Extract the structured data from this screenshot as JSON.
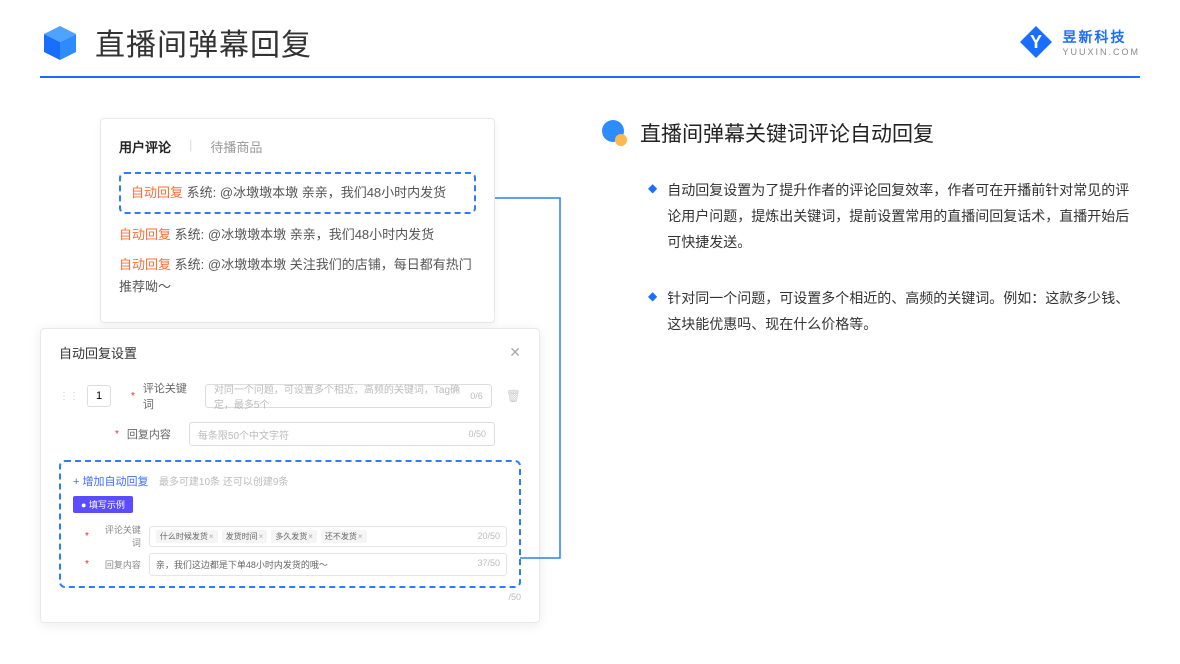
{
  "header": {
    "title": "直播间弹幕回复",
    "brand_name": "昱新科技",
    "brand_url": "YUUXIN.COM"
  },
  "comments_panel": {
    "tab_active": "用户评论",
    "tab_inactive": "待播商品",
    "auto_label": "自动回复",
    "system_prefix": "系统:",
    "c1": "@冰墩墩本墩 亲亲，我们48小时内发货",
    "c2": "@冰墩墩本墩 亲亲，我们48小时内发货",
    "c3": "@冰墩墩本墩 关注我们的店铺，每日都有热门推荐呦～"
  },
  "settings_panel": {
    "title": "自动回复设置",
    "idx": "1",
    "keyword_label": "评论关键词",
    "keyword_placeholder": "对同一个问题，可设置多个相近，高频的关键词，Tag确定，最多5个",
    "keyword_counter": "0/6",
    "content_label": "回复内容",
    "content_placeholder": "每条限50个中文字符",
    "content_counter": "0/50",
    "add_link": "+ 增加自动回复",
    "add_hint": "最多可建10条 还可以创建9条",
    "example_badge": "● 填写示例",
    "ex_kw_label": "评论关键词",
    "ex_tags": [
      "什么时候发货",
      "发货时间",
      "多久发货",
      "还不发货"
    ],
    "ex_kw_counter": "20/50",
    "ex_content_label": "回复内容",
    "ex_content": "亲，我们这边都是下单48小时内发货的哦～",
    "ex_content_counter": "37/50",
    "outer_counter": "/50"
  },
  "right": {
    "section_title": "直播间弹幕关键词评论自动回复",
    "bullet1": "自动回复设置为了提升作者的评论回复效率，作者可在开播前针对常见的评论用户问题，提炼出关键词，提前设置常用的直播间回复话术，直播开始后可快捷发送。",
    "bullet2": "针对同一个问题，可设置多个相近的、高频的关键词。例如：这款多少钱、这块能优惠吗、现在什么价格等。"
  }
}
